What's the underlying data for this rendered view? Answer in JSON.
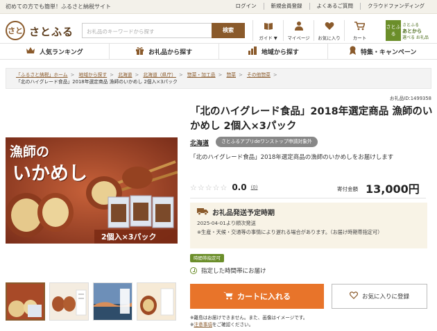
{
  "topbar": {
    "message": "初めての方でも簡単！ふるさと納税サイト",
    "links": [
      "ログイン",
      "新規会員登録",
      "よくあるご質問",
      "クラウドファンディング"
    ]
  },
  "header": {
    "logo_mark": "さと",
    "logo_text": "さとふる",
    "search_placeholder": "お礼品のキーワードから探す",
    "search_button": "検索",
    "icons": [
      {
        "label": "ガイド ▼",
        "icon": "book-icon"
      },
      {
        "label": "マイページ",
        "icon": "person-icon"
      },
      {
        "label": "お気に入り",
        "icon": "heart-icon"
      },
      {
        "label": "カート",
        "icon": "cart-icon"
      }
    ],
    "app_badge": {
      "left": "さとふる",
      "right_line1": "さとふる",
      "right_line2": "あとから",
      "right_line3": "選べる お礼品"
    }
  },
  "nav": [
    {
      "label": "人気ランキング",
      "icon": "crown-icon"
    },
    {
      "label": "お礼品から探す",
      "icon": "gift-icon"
    },
    {
      "label": "地域から探す",
      "icon": "map-icon"
    },
    {
      "label": "特集・キャンペーン",
      "icon": "ribbon-icon"
    }
  ],
  "breadcrumb": {
    "items": [
      "「ふるさと納税」ホーム",
      "地域から探す",
      "北海道",
      "北海道（県庁）",
      "惣菜・加工品",
      "惣菜",
      "その他惣菜"
    ],
    "current": "「北のハイグレード食品」2018年選定商品 漁師のいかめし 2個入×3パック"
  },
  "product": {
    "item_id": "お礼品ID:1499358",
    "title": "「北のハイグレード食品」2018年選定商品 漁師のいかめし 2個入×3パック",
    "prefecture": "北海道",
    "app_tag": "さとふるアプリdeワンストップ申請対象外",
    "description": "「北のハイグレード食品」2018年選定商品の漁師のいかめしをお届けします",
    "stars": "☆☆☆☆☆",
    "score": "0.0",
    "review_count": "(0)",
    "price_label": "寄付金額",
    "price": "13,000円",
    "image_text_1": "漁師の",
    "image_text_2": "いかめし",
    "image_text_3": "2個入×3パック"
  },
  "shipping": {
    "heading": "お礼品発送予定時期",
    "date": "2025-04-01より順次発送",
    "note": "※生産・天候・交通等の事情により遅れる場合があります。（お届け時期帯指定可）"
  },
  "delivery": {
    "badge": "時間帯指定可",
    "option": "指定した時間帯にお届け"
  },
  "actions": {
    "cart": "カートに入れる",
    "favorite": "お気に入りに登録"
  },
  "notes": {
    "line1": "※離島はお届けできません。また、画像はイメージです。",
    "line2_link": "注意事項",
    "line2_rest": "をご確認ください。"
  }
}
